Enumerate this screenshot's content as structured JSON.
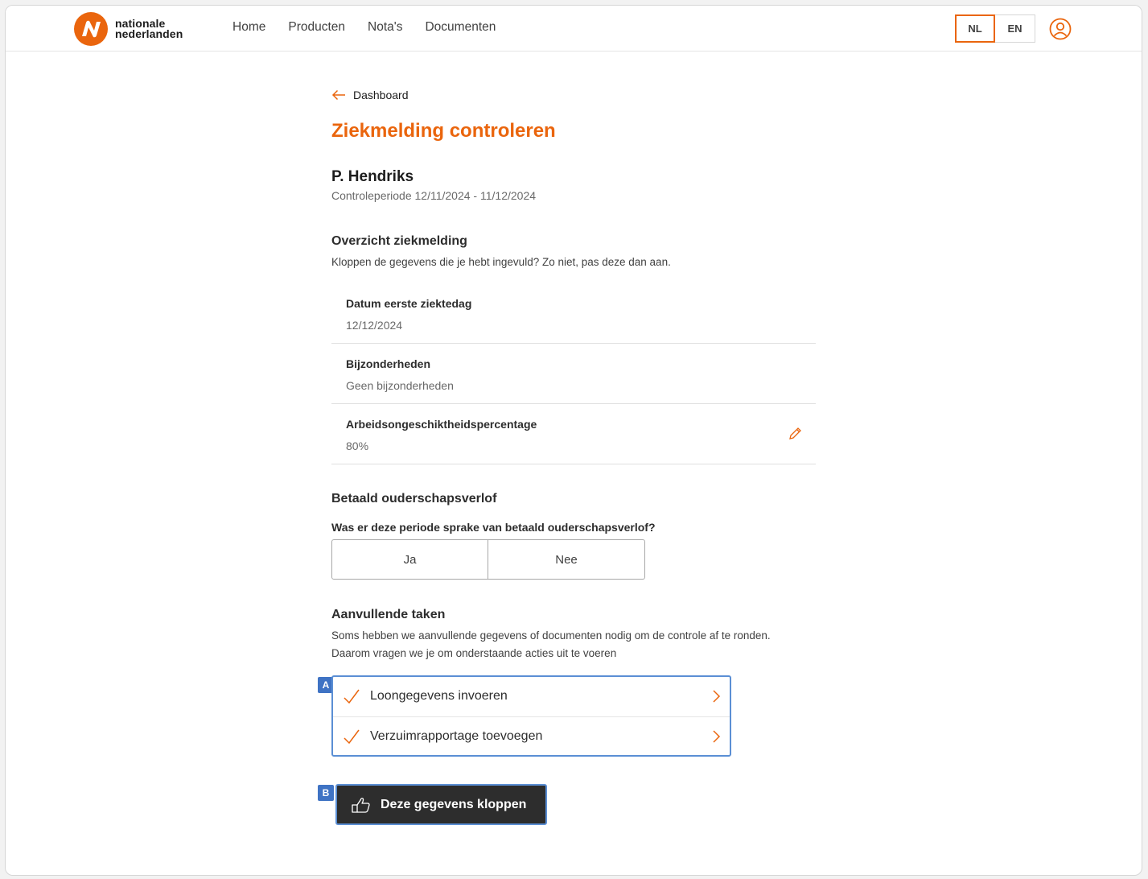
{
  "header": {
    "logo_line1": "nationale",
    "logo_line2": "nederlanden",
    "nav": [
      {
        "label": "Home"
      },
      {
        "label": "Producten"
      },
      {
        "label": "Nota's"
      },
      {
        "label": "Documenten"
      }
    ],
    "languages": [
      {
        "label": "NL",
        "active": true
      },
      {
        "label": "EN",
        "active": false
      }
    ],
    "user_icon": "user-circle-icon"
  },
  "back": {
    "label": "Dashboard",
    "icon": "arrow-left-icon"
  },
  "page_title": "Ziekmelding controleren",
  "employee": {
    "name": "P. Hendriks",
    "period": "Controleperiode 12/11/2024 - 11/12/2024"
  },
  "overview": {
    "title": "Overzicht ziekmelding",
    "description": "Kloppen de gegevens die je hebt ingevuld? Zo niet, pas deze dan aan.",
    "rows": [
      {
        "label": "Datum eerste ziektedag",
        "value": "12/12/2024",
        "editable": false
      },
      {
        "label": "Bijzonderheden",
        "value": "Geen bijzonderheden",
        "editable": false
      },
      {
        "label": "Arbeidsongeschiktheidspercentage",
        "value": "80%",
        "editable": true
      }
    ]
  },
  "parental_leave": {
    "title": "Betaald ouderschapsverlof",
    "question": "Was er deze periode sprake van betaald ouderschapsverlof?",
    "options": [
      {
        "label": "Ja"
      },
      {
        "label": "Nee"
      }
    ]
  },
  "tasks": {
    "title": "Aanvullende taken",
    "description": "Soms hebben we aanvullende gegevens of documenten nodig om de controle af te ronden. Daarom vragen we je om onderstaande acties uit te voeren",
    "badge": "A",
    "items": [
      {
        "label": "Loongegevens invoeren",
        "done": true
      },
      {
        "label": "Verzuimrapportage toevoegen",
        "done": true
      }
    ]
  },
  "confirm": {
    "label": "Deze gegevens kloppen",
    "badge": "B",
    "icon": "thumbs-up-icon"
  },
  "colors": {
    "brand_orange": "#ea650d",
    "annotation_blue": "#3f73c4",
    "button_dark": "#2d2d2d"
  }
}
